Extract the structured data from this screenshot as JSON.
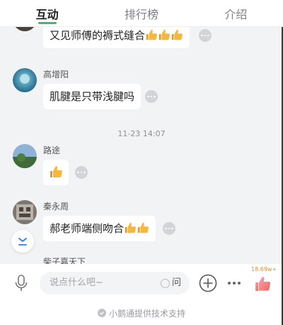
{
  "tabs": [
    {
      "label": "互动",
      "active": true
    },
    {
      "label": "排行榜",
      "active": false
    },
    {
      "label": "介绍",
      "active": false
    }
  ],
  "messages": [
    {
      "nickname": "",
      "text": "又见师傅的褥式缝合",
      "thumbs": 3
    },
    {
      "nickname": "高增阳",
      "text": "肌腱是只带浅腱吗",
      "thumbs": 0
    },
    {
      "nickname": "路途",
      "text": "",
      "thumbs": 1
    },
    {
      "nickname": "秦永周",
      "text": "郝老师端侧吻合",
      "thumbs": 2
    },
    {
      "nickname": "柴子嘉天下",
      "text": "",
      "thumbs": 0
    }
  ],
  "time_separator": "11-23 14:07",
  "input": {
    "placeholder": "说点什么吧~",
    "ask_label": "问"
  },
  "like_count": "18.69w+",
  "footer": {
    "text": "小鹅通提供技术支持"
  },
  "colors": {
    "accent": "#2fc26b",
    "like": "#f6a93b",
    "count": "#f08a1c"
  },
  "icons": {
    "mic": "microphone-icon",
    "plus": "plus-circle-icon",
    "more": "more-dots-icon",
    "like": "thumbs-up-icon",
    "scroll": "scroll-to-bottom-icon",
    "footer": "check-circle-icon"
  }
}
